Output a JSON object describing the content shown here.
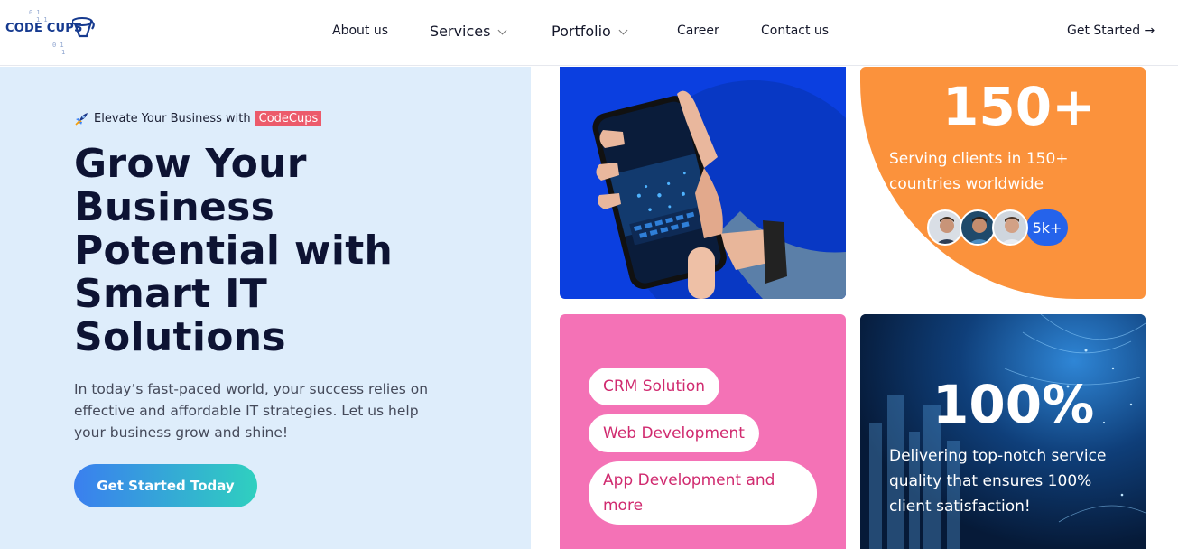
{
  "brand": {
    "logo_text": "CODE CUPS",
    "logo_bits": [
      "0 1",
      "1 1",
      "0 1",
      "1"
    ]
  },
  "nav": {
    "items": [
      {
        "label": "About us",
        "dropdown": false
      },
      {
        "label": "Services",
        "dropdown": true
      },
      {
        "label": "Portfolio",
        "dropdown": true
      },
      {
        "label": "Career",
        "dropdown": false
      },
      {
        "label": "Contact us",
        "dropdown": false
      }
    ],
    "cta": "Get Started →"
  },
  "hero": {
    "eyebrow_prefix": "Elevate Your Business with",
    "eyebrow_brand": "CodeCups",
    "headline_lines": [
      "Grow Your",
      "Business",
      "Potential with",
      "Smart IT",
      "Solutions"
    ],
    "description": "In today’s fast-paced world, your success relies on effective and affordable IT strategies. Let us help your business grow and shine!",
    "button": "Get Started Today"
  },
  "stat_clients": {
    "number": "150+",
    "text": "Serving clients in 150+ countries worldwide",
    "avatar_more": "5k+"
  },
  "services_card": {
    "pills": [
      "CRM Solution",
      "Web Development",
      "App Development and more"
    ]
  },
  "stat_quality": {
    "number": "100%",
    "text": "Delivering top-notch service quality that ensures 100% client satisfaction!"
  },
  "colors": {
    "accent_blue": "#0b3fe0",
    "orange": "#fb923c",
    "pink": "#f472b6",
    "brand_tag": "#ec5b6b",
    "hero_bg": "#deedfb"
  }
}
